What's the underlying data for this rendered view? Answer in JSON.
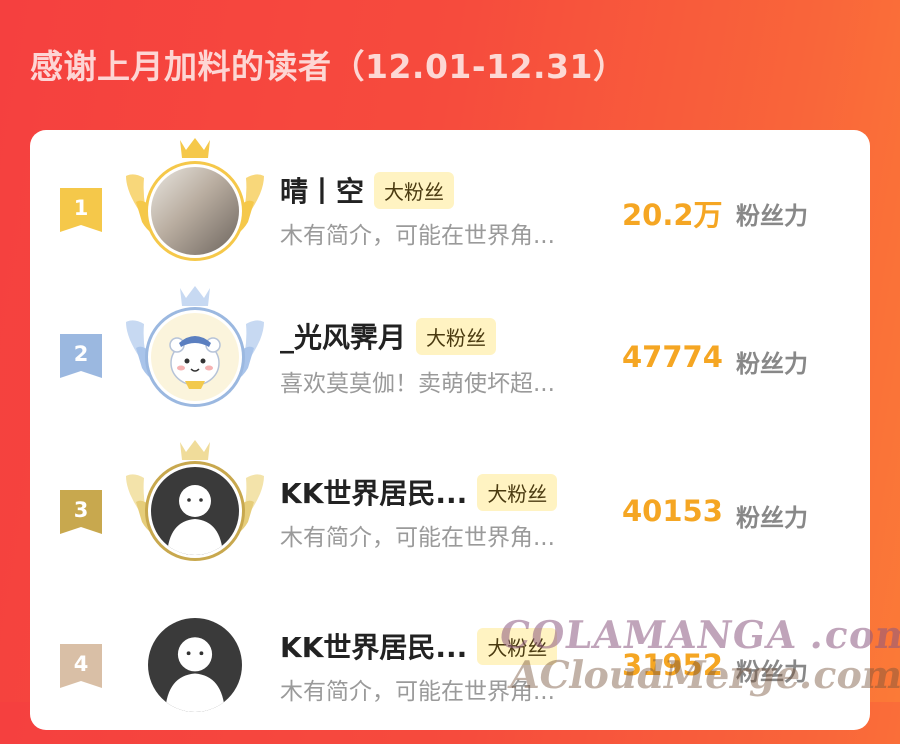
{
  "header": {
    "title": "感谢上月加料的读者（12.01-12.31）"
  },
  "ranking": [
    {
      "rank": "1",
      "name": "晴丨空",
      "badge": "大粉丝",
      "intro": "木有简介，可能在世界角...",
      "fans": "20.2万",
      "fans_label": "粉丝力"
    },
    {
      "rank": "2",
      "name": "_光风霁月",
      "badge": "大粉丝",
      "intro": "喜欢莫莫伽！卖萌使坏超...",
      "fans": "47774",
      "fans_label": "粉丝力"
    },
    {
      "rank": "3",
      "name": "KK世界居民...",
      "badge": "大粉丝",
      "intro": "木有简介，可能在世界角...",
      "fans": "40153",
      "fans_label": "粉丝力"
    },
    {
      "rank": "4",
      "name": "KK世界居民...",
      "badge": "大粉丝",
      "intro": "木有简介，可能在世界角...",
      "fans": "31952",
      "fans_label": "粉丝力"
    }
  ],
  "watermark": {
    "line1": "COLAMANGA .com",
    "line2": "ACloudMerge.com"
  },
  "colors": {
    "gold": "#f5c84a",
    "silver": "#9bb8e0",
    "bronze": "#c8a84e",
    "plain": "#d9bfa6",
    "fans": "#f5a623"
  }
}
